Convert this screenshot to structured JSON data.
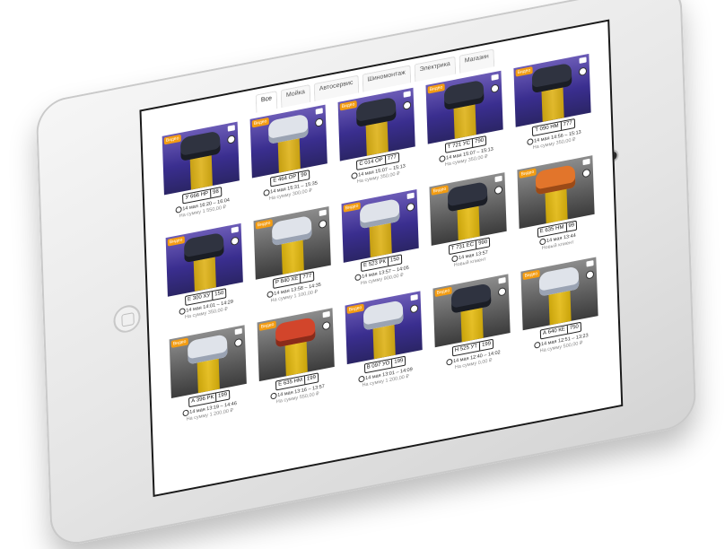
{
  "tabs": [
    "Все",
    "Мойка",
    "Автосервис",
    "Шиномонтаж",
    "Электрика",
    "Магазин"
  ],
  "cards": [
    {
      "plate": "У 666 НР",
      "region": "98",
      "time": "14 мая 16:20 – 16:04",
      "sum": "На сумму 1 550,00 ₽",
      "car": "dark",
      "photo": "purple"
    },
    {
      "plate": "Е 464 ОР",
      "region": "99",
      "time": "14 мая 15:31 – 15:35",
      "sum": "На сумму 300,00 ₽",
      "car": "light",
      "photo": "purple"
    },
    {
      "plate": "С 014 ОР",
      "region": "777",
      "time": "14 мая 15:07 – 15:13",
      "sum": "На сумму 350,00 ₽",
      "car": "dark",
      "photo": "purple"
    },
    {
      "plate": "Т 721 УС",
      "region": "790",
      "time": "14 мая 15:07 – 15:13",
      "sum": "На сумму 350,00 ₽",
      "car": "dark",
      "photo": "purple"
    },
    {
      "plate": "Т 090 НМ",
      "region": "777",
      "time": "14 мая 14:56 – 15:13",
      "sum": "На сумму 350,00 ₽",
      "car": "dark",
      "photo": "purple"
    },
    {
      "plate": "Е 300 ХУ",
      "region": "150",
      "time": "14 мая 14:01 – 14:29",
      "sum": "На сумму 350,00 ₽",
      "car": "dark",
      "photo": "purple"
    },
    {
      "plate": "Р 840 ХЕ",
      "region": "777",
      "time": "14 мая 13:58 – 14:35",
      "sum": "На сумму 1 100,00 ₽",
      "car": "light",
      "photo": "gray"
    },
    {
      "plate": "Е 523 РК",
      "region": "150",
      "time": "14 мая 13:57 – 14:05",
      "sum": "На сумму 900,00 ₽",
      "car": "light",
      "photo": "purple"
    },
    {
      "plate": "Т 731 ЕС",
      "region": "990",
      "time": "14 мая 13:57",
      "sum": "Новый клиент",
      "car": "dark",
      "photo": "gray"
    },
    {
      "plate": "Е 635 НМ",
      "region": "99",
      "time": "14 мая 13:44",
      "sum": "Новый клиент",
      "car": "orange",
      "photo": "gray"
    },
    {
      "plate": "А 396 РК",
      "region": "199",
      "time": "14 мая 13:19 – 14:46",
      "sum": "На сумму 1 200,00 ₽",
      "car": "light",
      "photo": "gray"
    },
    {
      "plate": "Е 635 НМ",
      "region": "199",
      "time": "14 мая 13:16 – 13:57",
      "sum": "На сумму 550,00 ₽",
      "car": "red",
      "photo": "gray"
    },
    {
      "plate": "В 097 УО",
      "region": "199",
      "time": "14 мая 13:01 – 14:09",
      "sum": "На сумму 1 200,00 ₽",
      "car": "light",
      "photo": "purple"
    },
    {
      "plate": "Н 525 УТ",
      "region": "199",
      "time": "14 мая 12:40 – 14:02",
      "sum": "На сумму 0,00 ₽",
      "car": "dark",
      "photo": "gray"
    },
    {
      "plate": "А 640 КЕ",
      "region": "750",
      "time": "14 мая 12:51 – 13:23",
      "sum": "На сумму 500,00 ₽",
      "car": "light",
      "photo": "gray"
    }
  ],
  "badge_text": "Видео",
  "colors": {
    "accent": "#f39c12",
    "bay": "#3a2e8f",
    "lift": "#ffd21f"
  }
}
